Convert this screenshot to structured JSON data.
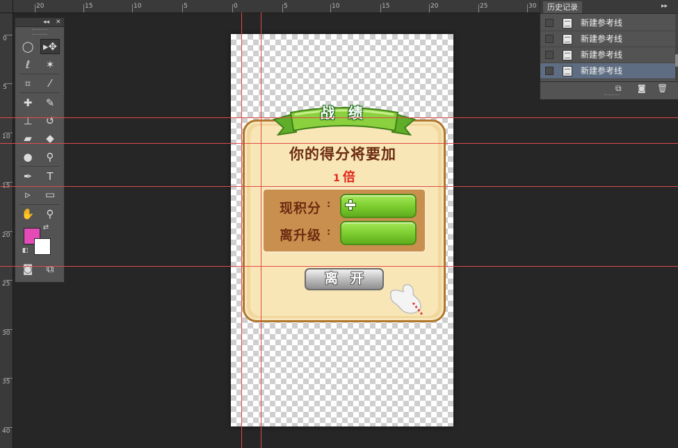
{
  "rulers": {
    "top_labels": [
      "20",
      "15",
      "10",
      "5",
      "0",
      "5",
      "10",
      "15",
      "20",
      "25",
      "30"
    ],
    "left_labels": [
      "0",
      "5",
      "10",
      "15",
      "20",
      "25",
      "30",
      "35",
      "40"
    ]
  },
  "game_ui": {
    "banner_title": "战 绩",
    "score_message": "你的得分将要加",
    "multiplier_number": "1",
    "multiplier_unit": "倍",
    "current_points_label": "现积分",
    "current_points_colon": ":",
    "level_up_label": "离升级",
    "level_up_colon": ":",
    "leave_button_label": "离开",
    "colors": {
      "panel": "#f1d79b",
      "panel_border": "#b0772d",
      "ribbon": "#8bd03e",
      "text_brown": "#6b2b10",
      "multiplier_red": "#e2261c",
      "green_bar": "#7acb2e"
    }
  },
  "toolbox": {
    "collapse_label": "◂◂",
    "close_label": "✕",
    "tools": [
      "elliptical-marquee-icon",
      "move-tool-icon",
      "lasso-icon",
      "magic-wand-icon",
      "crop-icon",
      "eyedropper-icon",
      "healing-brush-icon",
      "brush-icon",
      "clone-stamp-icon",
      "history-brush-icon",
      "eraser-icon",
      "paint-bucket-icon",
      "blur-icon",
      "dodge-icon",
      "pen-icon",
      "type-icon",
      "path-selection-icon",
      "rectangle-shape-icon",
      "hand-icon",
      "zoom-icon"
    ],
    "foreground_color": "#e44bb6",
    "background_color": "#ffffff"
  },
  "history_panel": {
    "tab_label": "历史记录",
    "menu_label": "▸▸",
    "items": [
      "新建参考线",
      "新建参考线",
      "新建参考线",
      "新建参考线"
    ],
    "active_index": 3
  }
}
